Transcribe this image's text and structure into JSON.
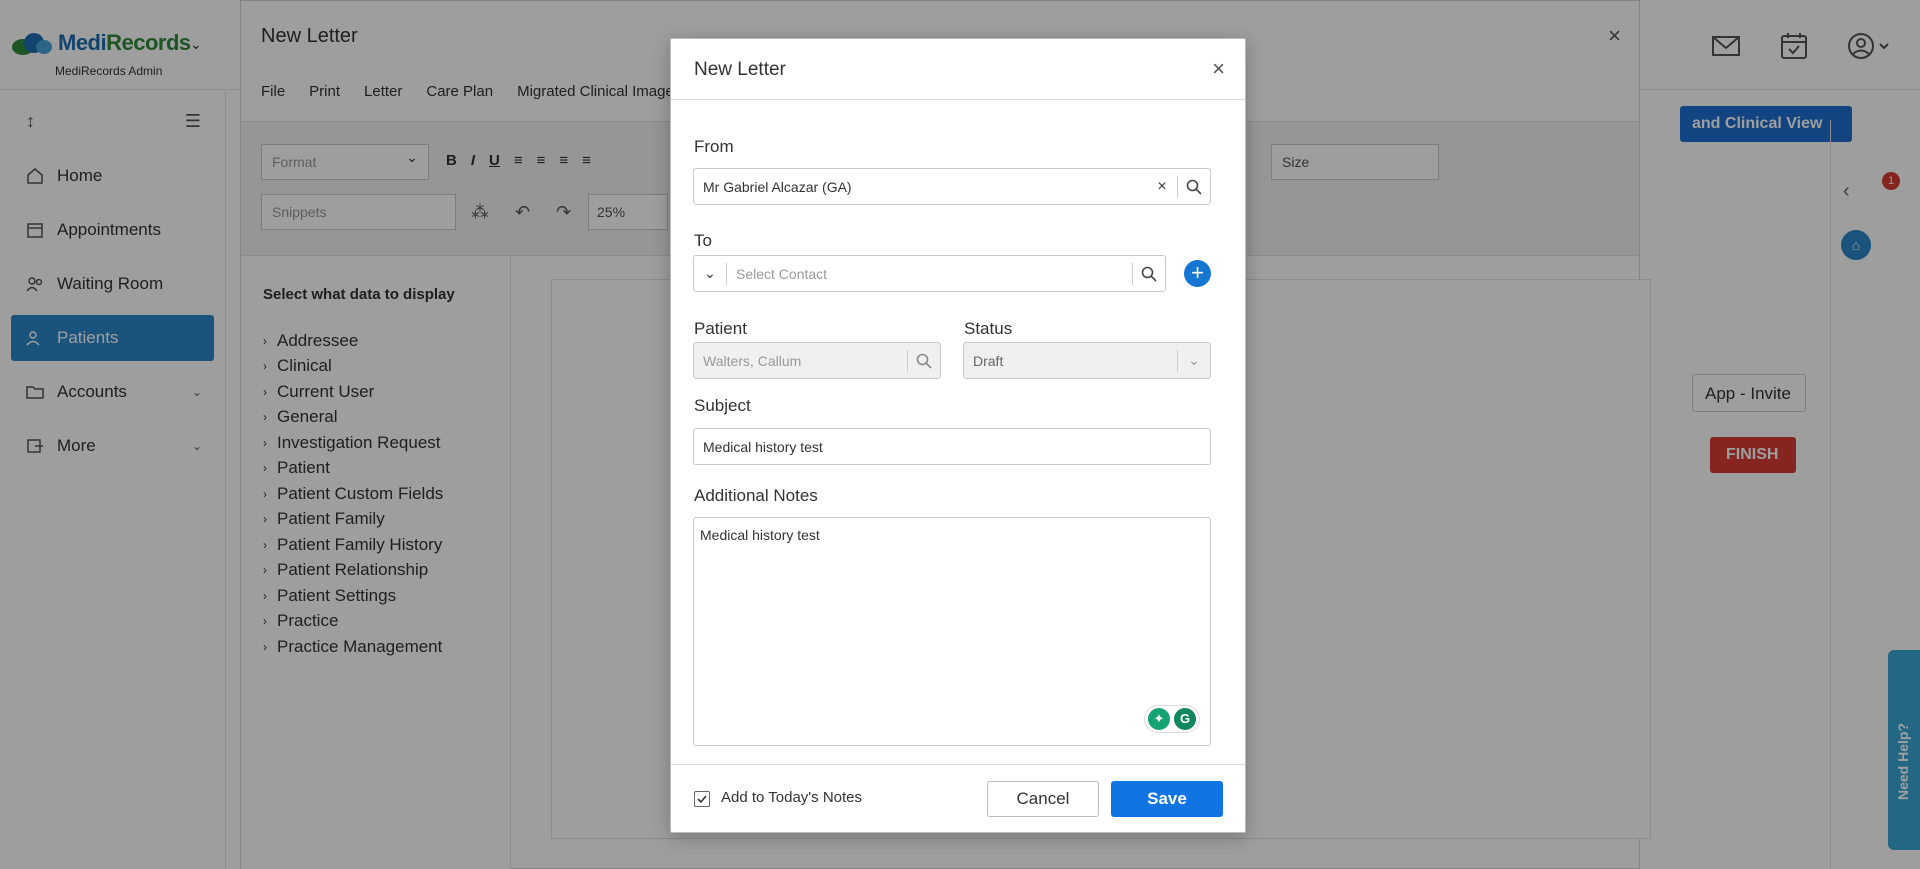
{
  "app": {
    "logo_text_blue": "Medi",
    "logo_text_green": "Records",
    "logo_sub": "MediRecords Admin"
  },
  "sidebar": {
    "items": [
      {
        "label": "Home",
        "icon": "home-icon"
      },
      {
        "label": "Appointments",
        "icon": "calendar-icon"
      },
      {
        "label": "Waiting Room",
        "icon": "people-icon"
      },
      {
        "label": "Patients",
        "icon": "patient-icon"
      },
      {
        "label": "Accounts",
        "icon": "folder-icon"
      },
      {
        "label": "More",
        "icon": "more-icon"
      }
    ]
  },
  "background_editor": {
    "title": "New Letter",
    "menu": [
      "File",
      "Print",
      "Letter",
      "Care Plan",
      "Migrated Clinical Image"
    ],
    "format_placeholder": "Format",
    "snippets_placeholder": "Snippets",
    "zoom": "25%",
    "size_placeholder": "Size",
    "data_panel_title": "Select what data to display",
    "data_items": [
      "Addressee",
      "Clinical",
      "Current User",
      "General",
      "Investigation Request",
      "Patient",
      "Patient Custom Fields",
      "Patient Family",
      "Patient Family History",
      "Patient Relationship",
      "Patient Settings",
      "Practice",
      "Practice Management"
    ]
  },
  "right_panel": {
    "clinical_view": "and Clinical View",
    "app_invite": "App - Invite",
    "finish": "FINISH",
    "need_help": "Need Help?",
    "badge_count": "1"
  },
  "modal": {
    "title": "New Letter",
    "from_label": "From",
    "from_value": "Mr Gabriel Alcazar (GA)",
    "to_label": "To",
    "to_placeholder": "Select Contact",
    "patient_label": "Patient",
    "patient_value": "Walters, Callum",
    "status_label": "Status",
    "status_value": "Draft",
    "subject_label": "Subject",
    "subject_value": "Medical history test",
    "notes_label": "Additional Notes",
    "notes_value": "Medical history test",
    "checkbox_label": "Add to Today's Notes",
    "checkbox_checked": true,
    "cancel_label": "Cancel",
    "save_label": "Save"
  },
  "colors": {
    "primary": "#1075e3",
    "nav_active": "#2a88c9",
    "finish": "#d93a34",
    "need_help": "#3aa7d5"
  }
}
